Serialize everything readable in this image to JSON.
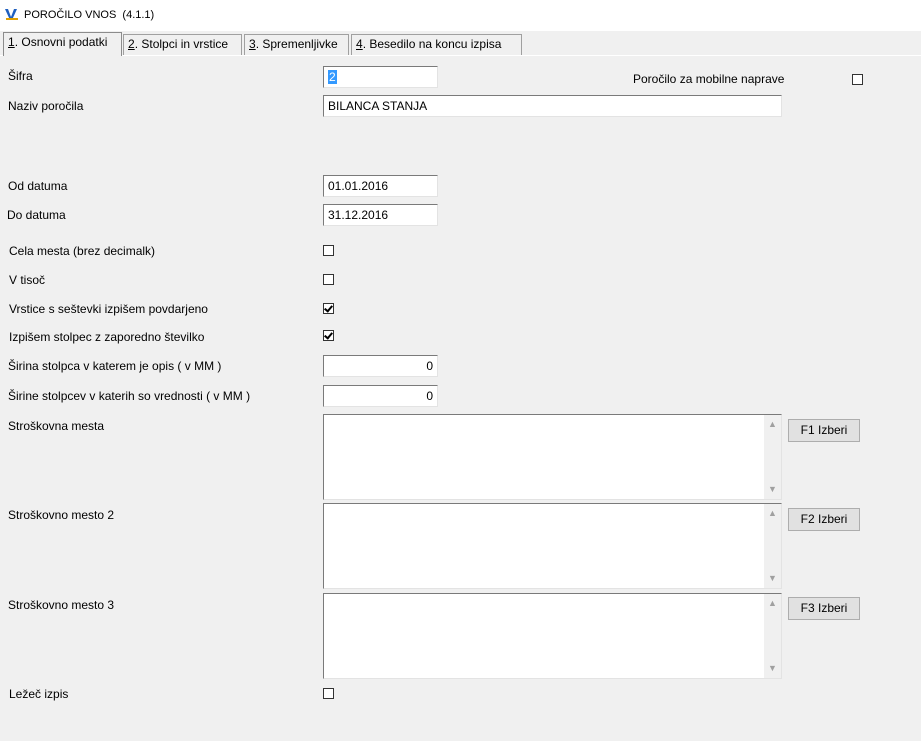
{
  "window": {
    "title": "POROČILO VNOS",
    "version": "(4.1.1)"
  },
  "tabs": [
    {
      "num": "1",
      "label": ". Osnovni podatki"
    },
    {
      "num": "2",
      "label": ". Stolpci in vrstice"
    },
    {
      "num": "3",
      "label": ". Spremenljivke"
    },
    {
      "num": "4",
      "label": ". Besedilo na koncu izpisa"
    }
  ],
  "form": {
    "sifra_label": "Šifra",
    "sifra_value": "2",
    "mobile_label": "Poročilo za mobilne naprave",
    "naziv_label": "Naziv poročila",
    "naziv_value": "BILANCA STANJA",
    "od_label": "Od datuma",
    "od_value": "01.01.2016",
    "do_label": "Do datuma",
    "do_value": "31.12.2016",
    "cela_label": "Cela mesta (brez decimalk)",
    "tisoc_label": "V tisoč",
    "vrstice_label": "Vrstice s seštevki izpišem povdarjeno",
    "stolpec_label": "Izpišem stolpec z zaporedno številko",
    "sirina_opis_label": "Širina stolpca v katerem je opis ( v MM )",
    "sirina_opis_value": "0",
    "sirine_vred_label": "Širine stolpcev v katerih so vrednosti ( v MM )",
    "sirine_vred_value": "0",
    "sm1_label": "Stroškovna mesta",
    "sm2_label": "Stroškovno mesto 2",
    "sm3_label": "Stroškovno mesto 3",
    "lezec_label": "Ležeč izpis"
  },
  "checkboxes": {
    "mobile": false,
    "cela": false,
    "tisoc": false,
    "vrstice": true,
    "stolpec": true,
    "lezec": false
  },
  "buttons": {
    "f1": "F1 Izberi",
    "f2": "F2 Izberi",
    "f3": "F3 Izberi"
  }
}
